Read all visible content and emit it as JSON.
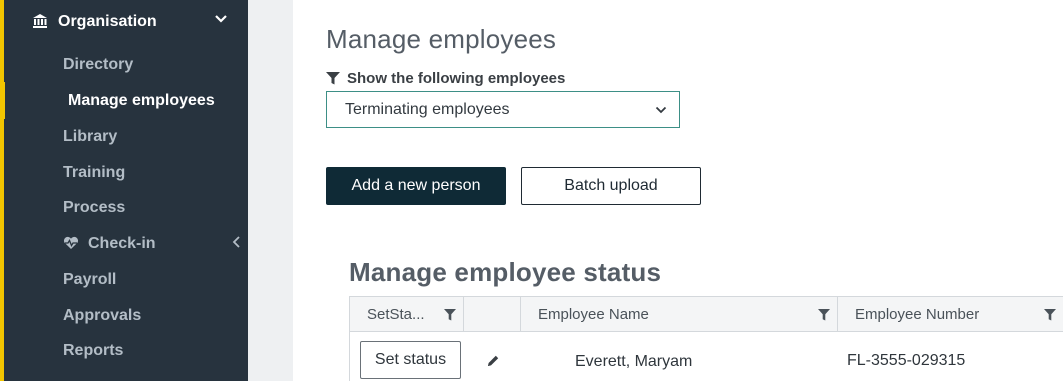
{
  "sidebar": {
    "section_title": "Organisation",
    "items": [
      {
        "label": "Directory"
      },
      {
        "label": "Manage employees"
      },
      {
        "label": "Library"
      },
      {
        "label": "Training"
      },
      {
        "label": "Process"
      },
      {
        "label": "Check-in"
      },
      {
        "label": "Payroll"
      },
      {
        "label": "Approvals"
      },
      {
        "label": "Reports"
      }
    ],
    "accent_color": "#f2c500"
  },
  "main": {
    "title": "Manage employees",
    "filter": {
      "label": "Show the following employees",
      "selected": "Terminating employees"
    },
    "buttons": {
      "add_person": "Add a new person",
      "batch_upload": "Batch upload"
    },
    "status_section": {
      "title": "Manage employee status",
      "columns": [
        "SetSta...",
        "",
        "Employee Name",
        "Employee Number"
      ],
      "rows": [
        {
          "action": "Set status",
          "name": "Everett, Maryam",
          "number": "FL-3555-029315"
        }
      ]
    }
  }
}
